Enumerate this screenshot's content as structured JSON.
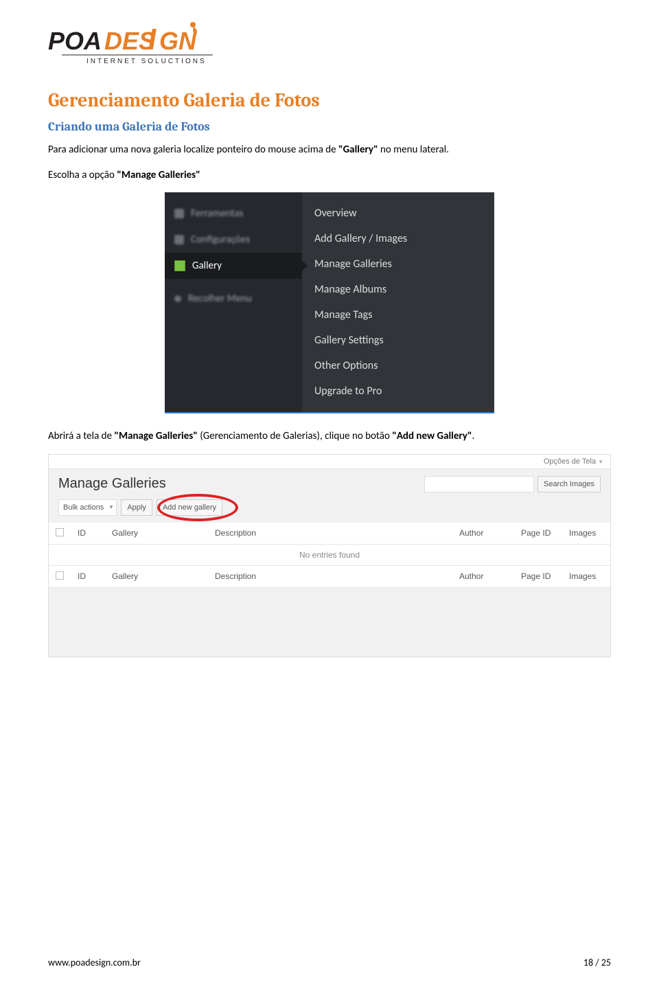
{
  "logo": {
    "name": "POADESIGN",
    "tagline": "INTERNET SOLUCTIONS"
  },
  "heading1": "Gerenciamento Galeria de Fotos",
  "heading2": "Criando uma Galeria de Fotos",
  "para1_a": "Para adicionar uma nova galeria localize ponteiro do mouse acima de ",
  "para1_b": "\"Gallery\"",
  "para1_c": " no menu lateral.",
  "para2_a": "Escolha a opção ",
  "para2_b": "\"Manage Galleries\"",
  "para3_a": "Abrirá a tela de ",
  "para3_b": "\"Manage Galleries\"",
  "para3_c": " (Gerenciamento de Galerias), clique no botão ",
  "para3_d": "\"Add new Gallery\"",
  "para3_e": ".",
  "s1": {
    "left_gallery": "Gallery",
    "menu": {
      "overview": "Overview",
      "add": "Add Gallery / Images",
      "manage_galleries": "Manage Galleries",
      "manage_albums": "Manage Albums",
      "manage_tags": "Manage Tags",
      "settings": "Gallery Settings",
      "other": "Other Options",
      "upgrade": "Upgrade to Pro"
    }
  },
  "s2": {
    "screen_options": "Opções de Tela",
    "title": "Manage Galleries",
    "search_btn": "Search Images",
    "bulk": "Bulk actions",
    "apply": "Apply",
    "add_new": "Add new gallery",
    "cols": {
      "id": "ID",
      "gallery": "Gallery",
      "desc": "Description",
      "author": "Author",
      "pageid": "Page ID",
      "images": "Images"
    },
    "noentries": "No entries found"
  },
  "footer": {
    "url": "www.poadesign.com.br",
    "page": "18 / 25"
  }
}
